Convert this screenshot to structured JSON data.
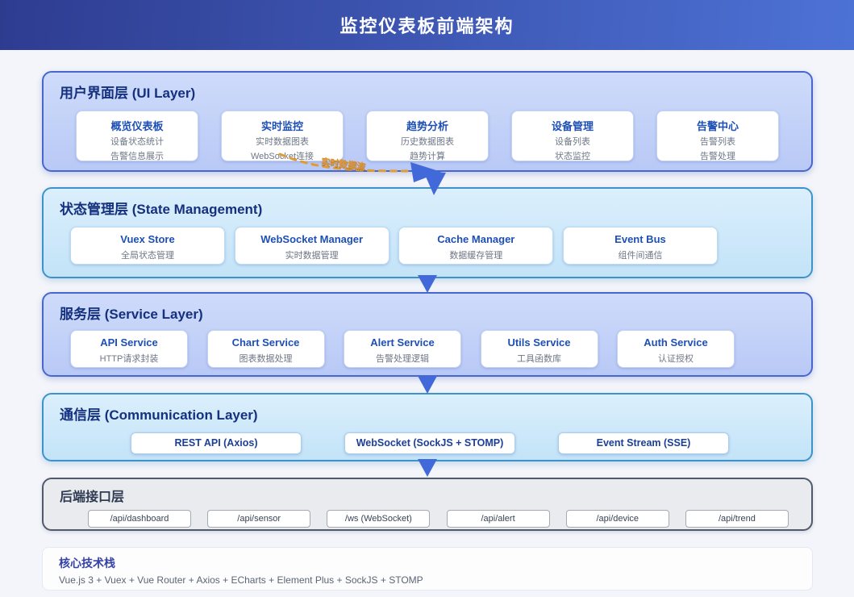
{
  "header": {
    "title": "监控仪表板前端架构"
  },
  "flow_label": "实时数据流",
  "layers": {
    "ui": {
      "title": "用户界面层 (UI Layer)",
      "cards": [
        {
          "title": "概览仪表板",
          "lines": [
            "设备状态统计",
            "告警信息展示"
          ]
        },
        {
          "title": "实时监控",
          "lines": [
            "实时数据图表",
            "WebSocket连接"
          ]
        },
        {
          "title": "趋势分析",
          "lines": [
            "历史数据图表",
            "趋势计算"
          ]
        },
        {
          "title": "设备管理",
          "lines": [
            "设备列表",
            "状态监控"
          ]
        },
        {
          "title": "告警中心",
          "lines": [
            "告警列表",
            "告警处理"
          ]
        }
      ]
    },
    "state": {
      "title": "状态管理层 (State Management)",
      "cards": [
        {
          "title": "Vuex Store",
          "lines": [
            "全局状态管理"
          ]
        },
        {
          "title": "WebSocket Manager",
          "lines": [
            "实时数据管理"
          ]
        },
        {
          "title": "Cache Manager",
          "lines": [
            "数据缓存管理"
          ]
        },
        {
          "title": "Event Bus",
          "lines": [
            "组件间通信"
          ]
        }
      ]
    },
    "service": {
      "title": "服务层 (Service Layer)",
      "cards": [
        {
          "title": "API Service",
          "lines": [
            "HTTP请求封装"
          ]
        },
        {
          "title": "Chart Service",
          "lines": [
            "图表数据处理"
          ]
        },
        {
          "title": "Alert Service",
          "lines": [
            "告警处理逻辑"
          ]
        },
        {
          "title": "Utils Service",
          "lines": [
            "工具函数库"
          ]
        },
        {
          "title": "Auth Service",
          "lines": [
            "认证授权"
          ]
        }
      ]
    },
    "communication": {
      "title": "通信层 (Communication Layer)",
      "cards": [
        {
          "title": "REST API (Axios)"
        },
        {
          "title": "WebSocket (SockJS + STOMP)"
        },
        {
          "title": "Event Stream (SSE)"
        }
      ]
    },
    "backend": {
      "title": "后端接口层",
      "cards": [
        {
          "title": "/api/dashboard"
        },
        {
          "title": "/api/sensor"
        },
        {
          "title": "/ws (WebSocket)"
        },
        {
          "title": "/api/alert"
        },
        {
          "title": "/api/device"
        },
        {
          "title": "/api/trend"
        }
      ]
    }
  },
  "tech_stack": {
    "title": "核心技术栈",
    "content": "Vue.js 3 + Vuex + Vue Router + Axios + ECharts + Element Plus + SockJS + STOMP"
  },
  "colors": {
    "header_gradient_start": "#2e3c90",
    "header_gradient_end": "#4d72d6",
    "blue_layer_border": "#4866cc",
    "cyan_layer_border": "#3d93c9",
    "backend_border": "#515a6b",
    "layer_title": "#14307e",
    "card_title": "#1d4fb5",
    "subtitle": "#6e7787",
    "flow_dash": "#dd9c35",
    "arrow": "#4169d9"
  }
}
